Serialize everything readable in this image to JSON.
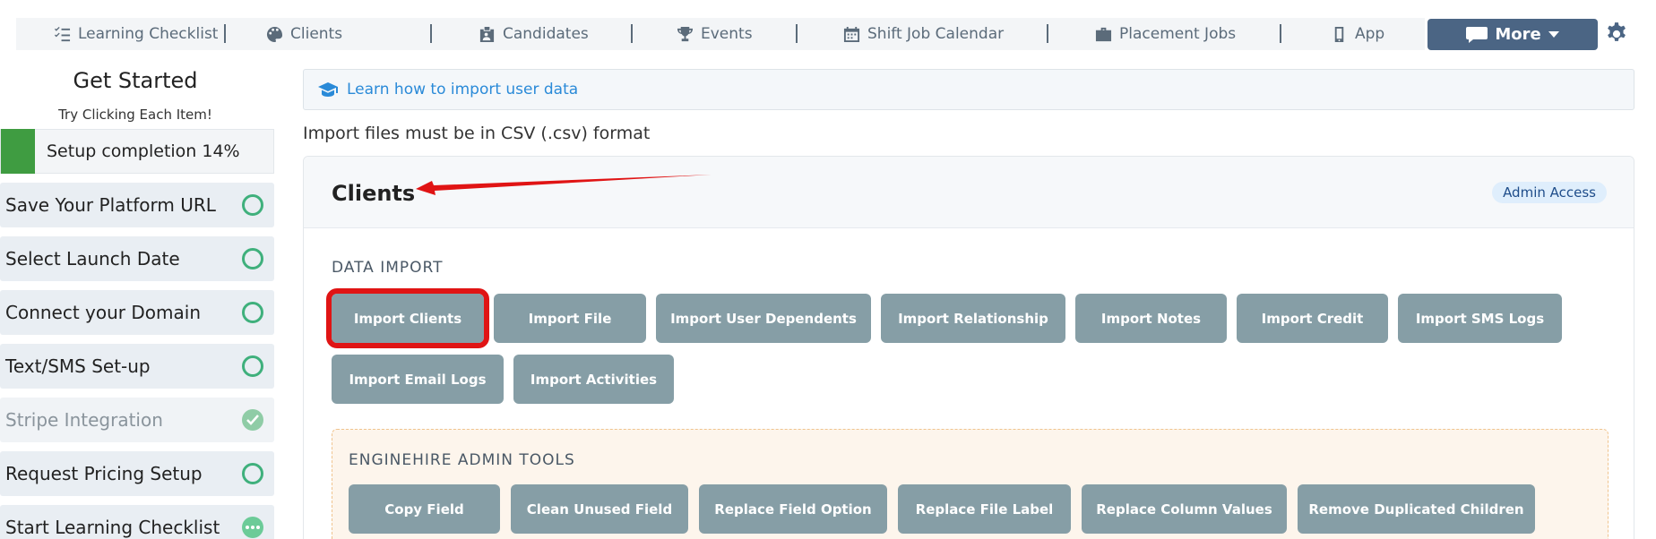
{
  "nav": {
    "items": [
      {
        "label": "Learning Checklist",
        "icon": "checklist-icon"
      },
      {
        "label": "Clients",
        "icon": "palette-icon"
      },
      {
        "label": "Candidates",
        "icon": "id-badge-icon"
      },
      {
        "label": "Events",
        "icon": "trophy-icon"
      },
      {
        "label": "Shift Job Calendar",
        "icon": "calendar-icon"
      },
      {
        "label": "Placement Jobs",
        "icon": "briefcase-icon"
      },
      {
        "label": "App",
        "icon": "mobile-icon"
      }
    ],
    "more_label": "More",
    "more_icon": "message-icon",
    "settings_icon": "gear-icon"
  },
  "sidebar": {
    "title": "Get Started",
    "subtitle": "Try Clicking Each Item!",
    "progress_label": "Setup completion 14%",
    "progress_percent": 14,
    "items": [
      {
        "label": "Save Your Platform URL",
        "status": "todo"
      },
      {
        "label": "Select Launch Date",
        "status": "todo"
      },
      {
        "label": "Connect your Domain",
        "status": "todo"
      },
      {
        "label": "Text/SMS Set-up",
        "status": "todo"
      },
      {
        "label": "Stripe Integration",
        "status": "done"
      },
      {
        "label": "Request Pricing Setup",
        "status": "todo"
      },
      {
        "label": "Start Learning Checklist",
        "status": "in-progress"
      }
    ]
  },
  "main": {
    "learn_link": "Learn how to import user data",
    "csv_note": "Import files must be in CSV (.csv) format",
    "card": {
      "title": "Clients",
      "badge": "Admin Access",
      "data_import_label": "DATA IMPORT",
      "import_buttons": [
        "Import Clients",
        "Import File",
        "Import User Dependents",
        "Import Relationship",
        "Import Notes",
        "Import Credit",
        "Import SMS Logs",
        "Import Email Logs",
        "Import Activities"
      ],
      "admin_tools_label": "ENGINEHIRE ADMIN TOOLS",
      "admin_buttons": [
        "Copy Field",
        "Clean Unused Field",
        "Replace Field Option",
        "Replace File Label",
        "Replace Column Values",
        "Remove Duplicated Children"
      ]
    }
  },
  "colors": {
    "nav_text": "#5b6b7a",
    "more_bg": "#4b6584",
    "button_bg": "#869ea6",
    "progress_green": "#3f9c41",
    "status_green": "#3fb07c",
    "link_blue": "#2a8ad8",
    "highlight_red": "#e01414"
  }
}
